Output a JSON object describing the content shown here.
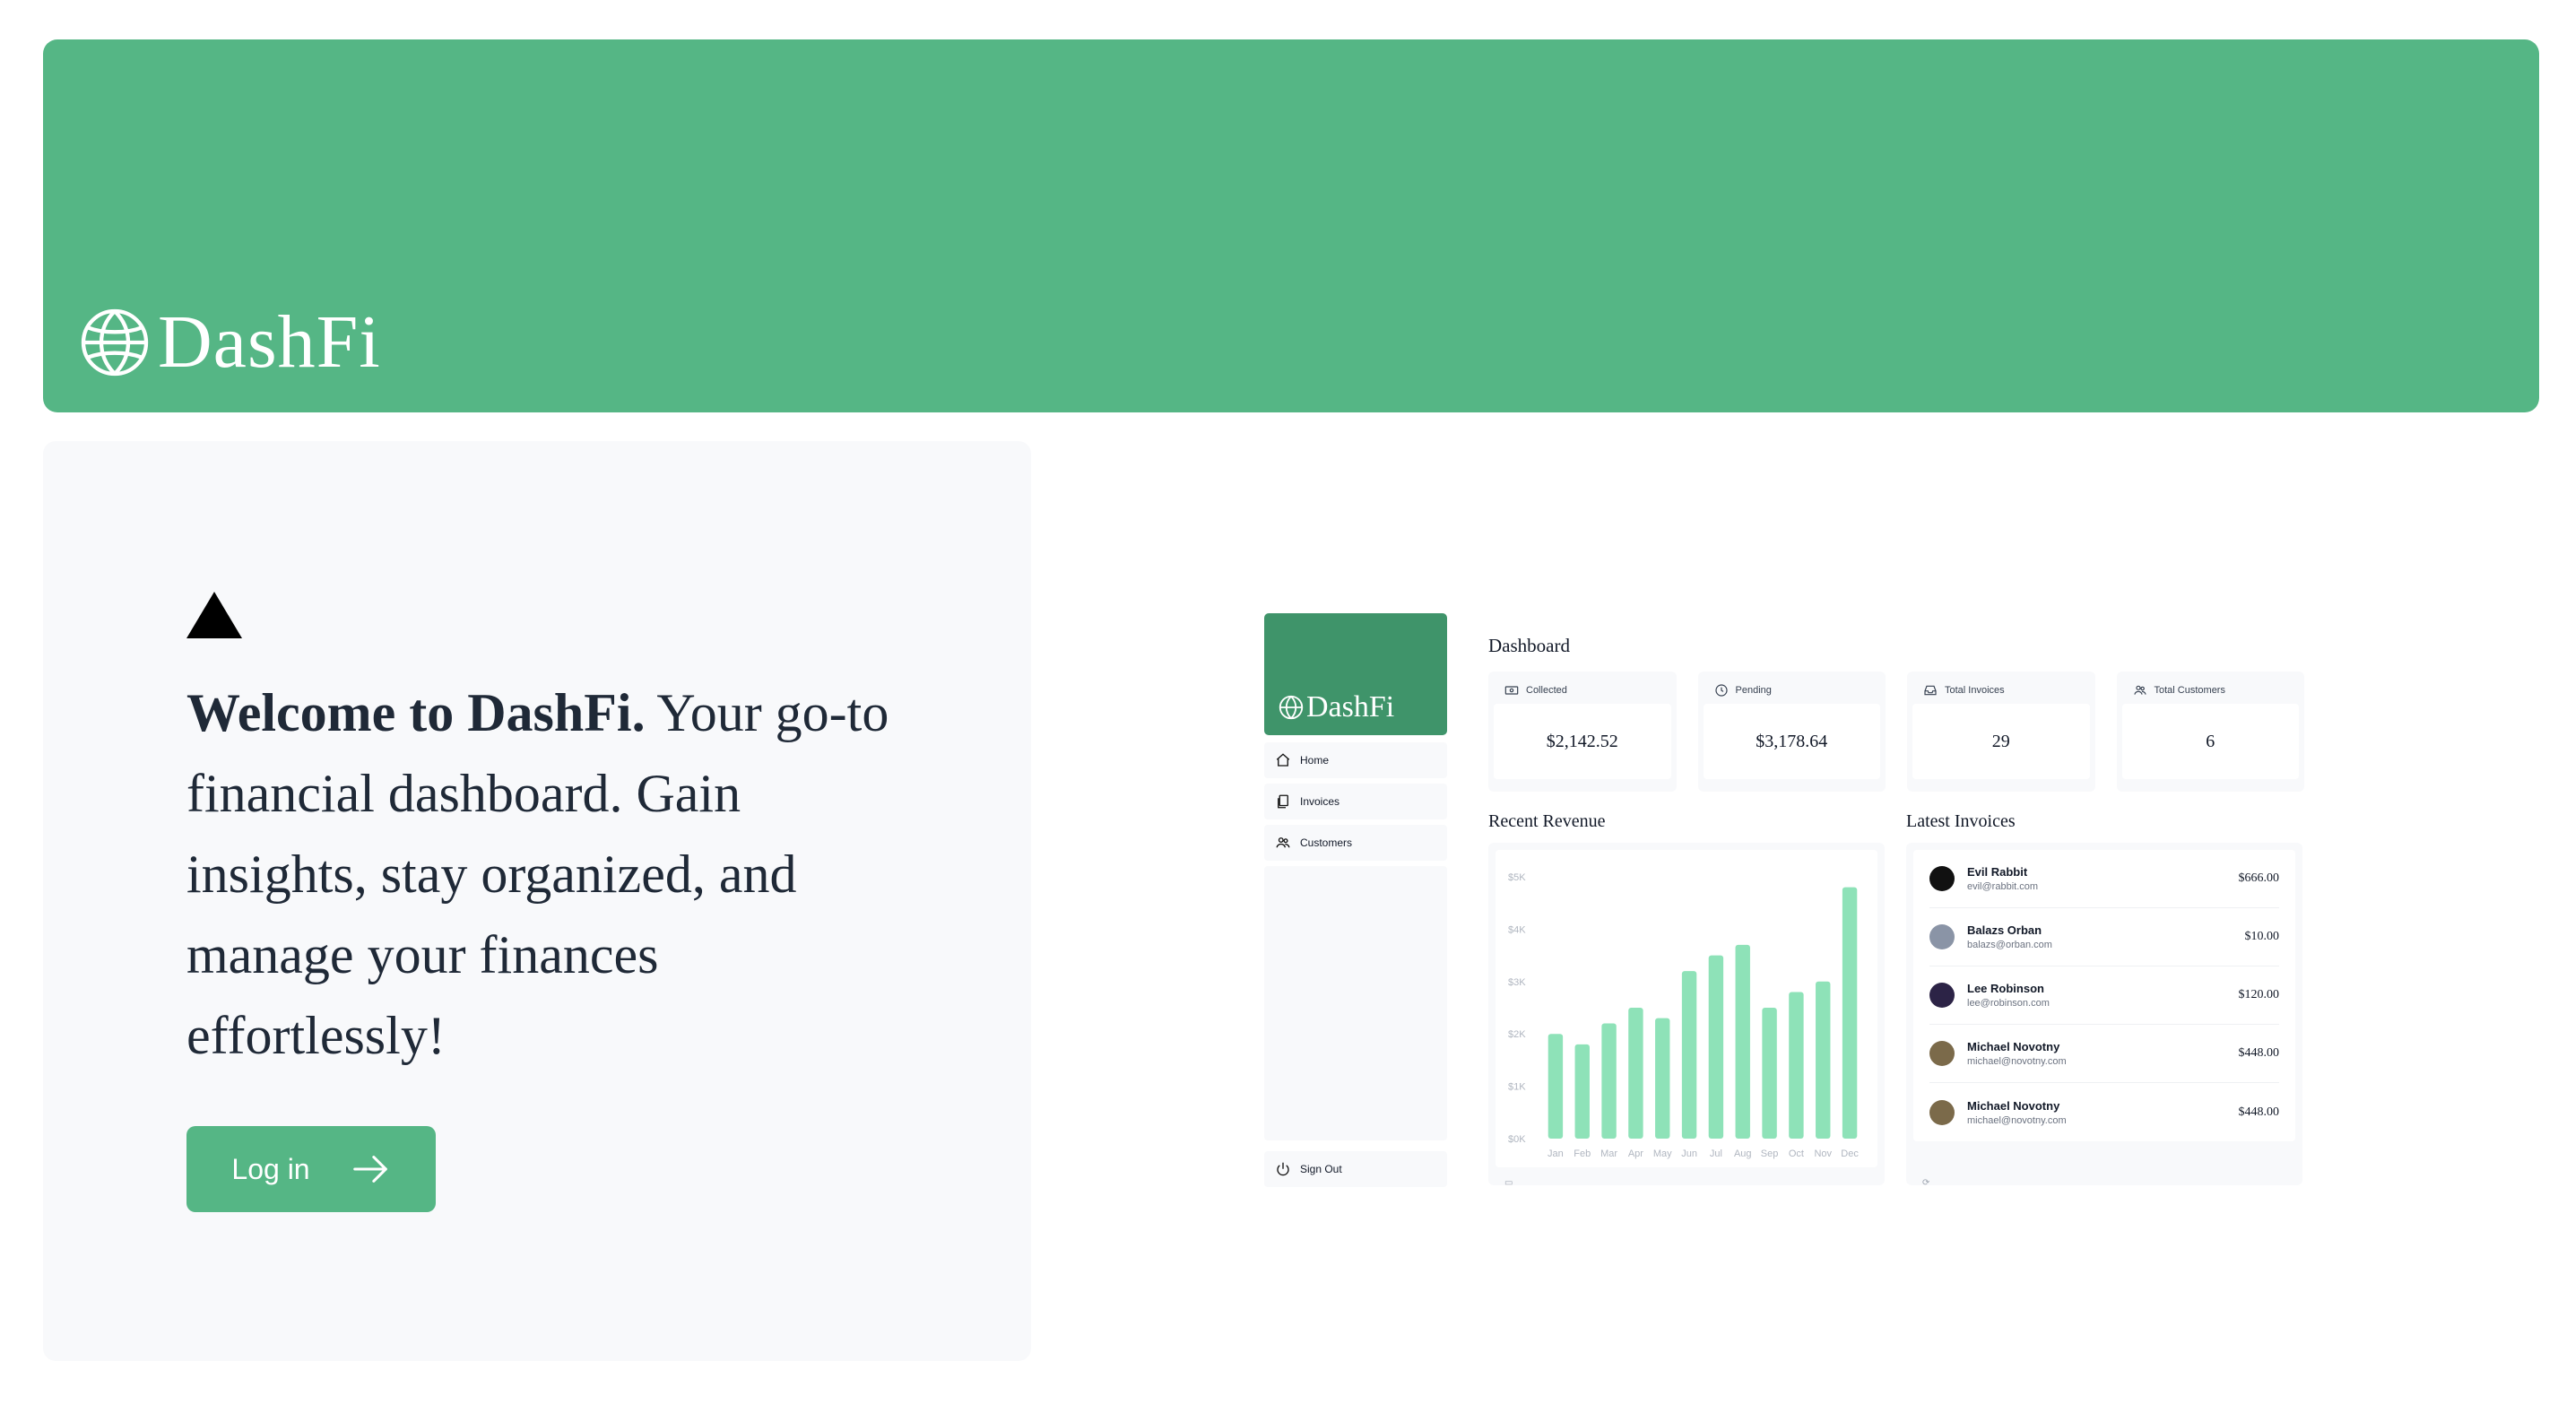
{
  "brand": {
    "name": "DashFi",
    "accent": "#55b685",
    "accent_dark": "#3f946a",
    "logo_icon": "globe-icon"
  },
  "hero": {
    "welcome_bold": "Welcome to DashFi.",
    "welcome_rest": " Your go-to financial dashboard. Gain insights, stay organized, and manage your finances effortlessly!",
    "login_label": "Log in",
    "login_icon": "arrow-right-icon",
    "logo_mark": "triangle-icon"
  },
  "preview": {
    "sidebar": {
      "brand": "DashFi",
      "items": [
        {
          "label": "Home",
          "icon": "home-icon"
        },
        {
          "label": "Invoices",
          "icon": "document-icon"
        },
        {
          "label": "Customers",
          "icon": "users-icon"
        }
      ],
      "signout": "Sign Out"
    },
    "title": "Dashboard",
    "cards": [
      {
        "label": "Collected",
        "value": "$2,142.52",
        "icon": "banknote-icon"
      },
      {
        "label": "Pending",
        "value": "$3,178.64",
        "icon": "clock-icon"
      },
      {
        "label": "Total Invoices",
        "value": "29",
        "icon": "inbox-icon"
      },
      {
        "label": "Total Customers",
        "value": "6",
        "icon": "users-icon"
      }
    ],
    "revenue_title": "Recent Revenue",
    "invoices_title": "Latest Invoices",
    "invoices": [
      {
        "name": "Evil Rabbit",
        "email": "evil@rabbit.com",
        "amount": "$666.00",
        "avatar_color": "#111111"
      },
      {
        "name": "Balazs Orban",
        "email": "balazs@orban.com",
        "amount": "$10.00",
        "avatar_color": "#8a94a6"
      },
      {
        "name": "Lee Robinson",
        "email": "lee@robinson.com",
        "amount": "$120.00",
        "avatar_color": "#2c2346"
      },
      {
        "name": "Michael Novotny",
        "email": "michael@novotny.com",
        "amount": "$448.00",
        "avatar_color": "#7b6a4a"
      },
      {
        "name": "Michael Novotny",
        "email": "michael@novotny.com",
        "amount": "$448.00",
        "avatar_color": "#7b6a4a"
      }
    ]
  },
  "chart_data": {
    "type": "bar",
    "categories": [
      "Jan",
      "Feb",
      "Mar",
      "Apr",
      "May",
      "Jun",
      "Jul",
      "Aug",
      "Sep",
      "Oct",
      "Nov",
      "Dec"
    ],
    "values": [
      2000,
      1800,
      2200,
      2500,
      2300,
      3200,
      3500,
      3700,
      2500,
      2800,
      3000,
      4800
    ],
    "y_ticks": [
      "$5K",
      "$4K",
      "$3K",
      "$2K",
      "$1K",
      "$0K"
    ],
    "ylim": [
      0,
      5000
    ],
    "bar_color": "#8ee2b8",
    "grid": false
  }
}
